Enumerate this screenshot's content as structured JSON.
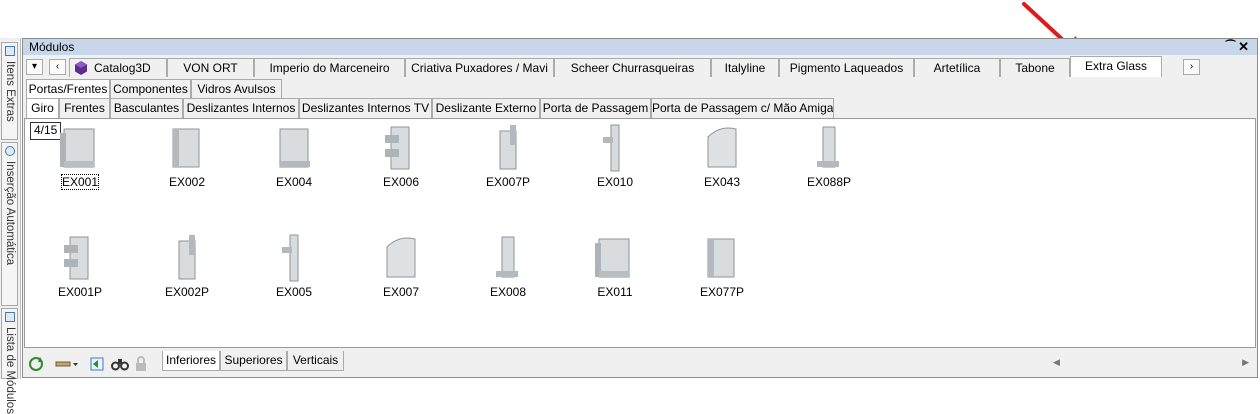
{
  "side_panel": {
    "tabs": [
      {
        "label": "Itens Extras",
        "icon": "layers-icon"
      },
      {
        "label": "Inserção Automática",
        "icon": "auto-insert-icon"
      },
      {
        "label": "Lista de Módulos",
        "icon": "list-icon"
      }
    ]
  },
  "panel": {
    "title": "Módulos",
    "pin_glyph": "⁀",
    "close_glyph": "✕"
  },
  "catalog_tabs": [
    "Catalog3D",
    "VON ORT",
    "Imperio do Marceneiro",
    "Criativa Puxadores / Mavi",
    "Scheer Churrasqueiras",
    "Italyline",
    "Pigmento Laqueados",
    "Artetílica",
    "Tabone",
    "Extra Glass"
  ],
  "category_tabs": [
    "Portas/Frentes",
    "Componentes",
    "Vidros Avulsos"
  ],
  "subcategory_tabs": [
    "Giro",
    "Frentes",
    "Basculantes",
    "Deslizantes Internos",
    "Deslizantes Internos TV",
    "Deslizante Externo",
    "Porta de Passagem",
    "Porta de Passagem c/ Mão Amiga"
  ],
  "pager": "4/15",
  "items": [
    {
      "code": "EX001"
    },
    {
      "code": "EX002"
    },
    {
      "code": "EX004"
    },
    {
      "code": "EX006"
    },
    {
      "code": "EX007P"
    },
    {
      "code": "EX010"
    },
    {
      "code": "EX043"
    },
    {
      "code": "EX088P"
    },
    {
      "code": "EX001P"
    },
    {
      "code": "EX002P"
    },
    {
      "code": "EX005"
    },
    {
      "code": "EX007"
    },
    {
      "code": "EX008"
    },
    {
      "code": "EX011"
    },
    {
      "code": "EX077P"
    }
  ],
  "bottom_tabs": [
    "Inferiores",
    "Superiores",
    "Verticais"
  ],
  "colors": {
    "accent": "#c8d6ea",
    "annotation_arrow": "#e01a1a"
  }
}
